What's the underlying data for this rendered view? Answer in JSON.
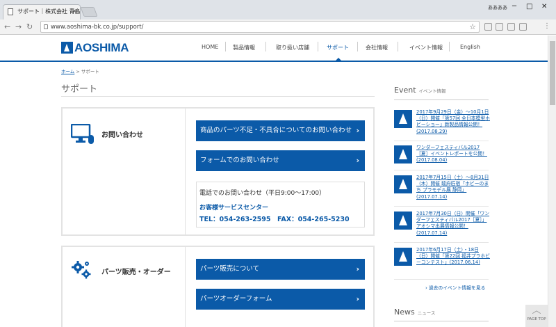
{
  "browser": {
    "tab_title": "サポート｜株式会社 青島文",
    "url": "www.aoshima-bk.co.jp/support/",
    "user_label": "ああああ"
  },
  "site": {
    "logo_text": "AOSHIMA",
    "nav": [
      "HOME",
      "製品情報",
      "取り扱い店舗",
      "サポート",
      "会社情報",
      "イベント情報",
      "English"
    ],
    "active_nav": "サポート",
    "breadcrumb": {
      "home": "ホーム",
      "sep": ">",
      "current": "サポート"
    },
    "page_title": "サポート"
  },
  "inquiry": {
    "label": "お問い合わせ",
    "btn_parts": "商品のパーツ不足・不具合についてのお問い合わせ",
    "btn_form": "フォームでのお問い合わせ",
    "phone_heading": "電話でのお問い合わせ（平日9:00～17:00）",
    "center": "お客様サービスセンター",
    "tel_fax": "TEL：054-263-2595　FAX：054-265-5230"
  },
  "parts": {
    "label": "パーツ販売・オーダー",
    "btn_about": "パーツ販売について",
    "btn_order": "パーツオーダーフォーム"
  },
  "sidebar": {
    "event_heading": "Event",
    "event_sub": "イベント情報",
    "events": [
      "2017年9月29日（金）～10月1日（日）開催「第57回 全日本模型ホビーショー」新製品情報公開！(2017.08.29)",
      "ワンダーフェスティバル2017［夏］イベントレポートを公開！ (2017.08.04)",
      "2017年7月15日（土）～8月31日（木）開催 駿府匠宿「ホビーのまち プラモデル展 静岡」(2017.07.14)",
      "2017年7月30日（日）開催「ワンダーフェスティバル2017［夏］」アオシマ出展情報公開！ (2017.07.14)",
      "2017年6月17日（土）・18日（日）開催「第22回 福井プラホビーコンテスト」(2017.06.14)"
    ],
    "more": "過去のイベント情報を見る",
    "news_heading": "News",
    "news_sub": "ニュース"
  },
  "pagetop": "PAGE TOP"
}
